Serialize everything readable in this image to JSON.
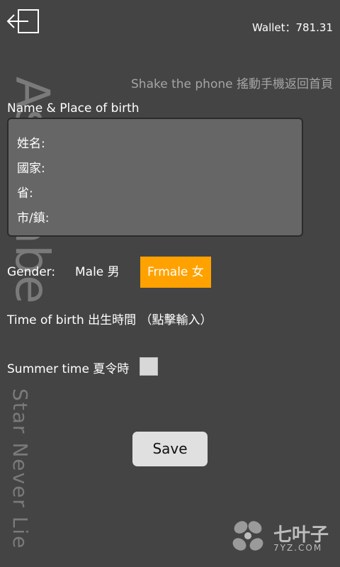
{
  "watermark": {
    "title": "Astrolabe",
    "subtitle": "Star Never Lie"
  },
  "header": {
    "wallet": "Wallet：781.31"
  },
  "hint": "Shake the phone 搖動手機返回首頁",
  "name_section": {
    "label": "Name & Place of birth",
    "fields": [
      "姓名:",
      "國家:",
      "省:",
      "市/鎮:"
    ]
  },
  "gender": {
    "label": "Gender:",
    "options": [
      "Male 男",
      "Frmale 女"
    ],
    "selected": "Frmale 女"
  },
  "time_of_birth": {
    "label": "Time of birth 出生時間 （點擊輸入）"
  },
  "summer_time": {
    "label": "Summer time 夏令時",
    "checked": false
  },
  "save_button": {
    "label": "Save"
  },
  "logo": {
    "name": "七叶子",
    "domain": "7YZ.COM"
  },
  "icons": {
    "back": "back-arrow-icon",
    "logo": "leaf-logo-icon"
  },
  "colors": {
    "background": "#444444",
    "selected": "#ffa200",
    "input_bg": "#666666"
  }
}
